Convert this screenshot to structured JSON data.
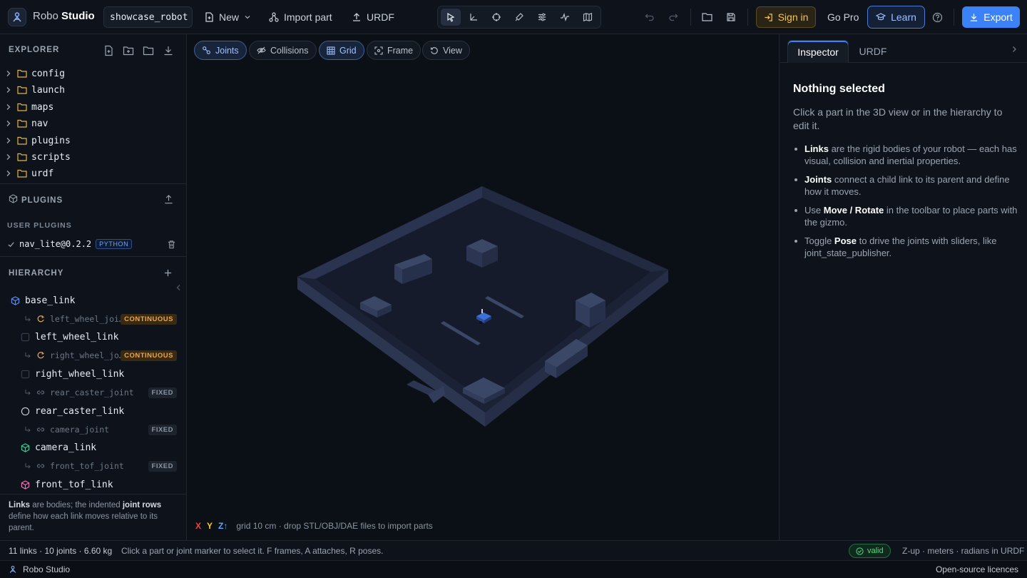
{
  "app": {
    "brand_light": "Robo",
    "brand_bold": "Studio",
    "project_name": "showcase_robot"
  },
  "toolbar": {
    "new_label": "New",
    "import_label": "Import part",
    "urdf_label": "URDF",
    "signin_label": "Sign in",
    "gopro_label": "Go Pro",
    "learn_label": "Learn",
    "export_label": "Export"
  },
  "explorer": {
    "title": "EXPLORER",
    "folders": [
      "config",
      "launch",
      "maps",
      "nav",
      "plugins",
      "scripts",
      "urdf"
    ]
  },
  "plugins": {
    "title": "PLUGINS",
    "user_title": "USER PLUGINS",
    "installed": "nav_lite@0.2.2",
    "lang_badge": "PYTHON"
  },
  "hierarchy": {
    "title": "HIERARCHY",
    "items": [
      {
        "kind": "link",
        "name": "base_link"
      },
      {
        "kind": "joint",
        "name": "left_wheel_joi…",
        "type": "CONTINUOUS"
      },
      {
        "kind": "link",
        "name": "left_wheel_link"
      },
      {
        "kind": "joint",
        "name": "right_wheel_jo…",
        "type": "CONTINUOUS"
      },
      {
        "kind": "link",
        "name": "right_wheel_link"
      },
      {
        "kind": "joint",
        "name": "rear_caster_joint",
        "type": "FIXED"
      },
      {
        "kind": "link",
        "name": "rear_caster_link"
      },
      {
        "kind": "joint",
        "name": "camera_joint",
        "type": "FIXED"
      },
      {
        "kind": "link",
        "name": "camera_link"
      },
      {
        "kind": "joint",
        "name": "front_tof_joint",
        "type": "FIXED"
      },
      {
        "kind": "link",
        "name": "front_tof_link"
      }
    ],
    "note_b1": "Links",
    "note_t1": " are bodies; the indented ",
    "note_b2": "joint rows",
    "note_t2": " define how each link moves relative to its parent."
  },
  "viewport": {
    "chips": {
      "joints": "Joints",
      "collisions": "Collisions",
      "grid": "Grid",
      "frame": "Frame",
      "view": "View"
    },
    "axis_x": "X",
    "axis_y": "Y",
    "axis_z": "Z↑",
    "hint": "grid 10 cm · drop STL/OBJ/DAE files to import parts"
  },
  "inspector": {
    "tab_active": "Inspector",
    "tab_other": "URDF",
    "title": "Nothing selected",
    "desc": "Click a part in the 3D view or in the hierarchy to edit it.",
    "bullets": [
      {
        "b": "Links",
        "t": " are the rigid bodies of your robot — each has visual, collision and inertial properties."
      },
      {
        "b": "Joints",
        "t": " connect a child link to its parent and define how it moves."
      },
      {
        "pre": "Use ",
        "b": "Move / Rotate",
        "t": " in the toolbar to place parts with the gizmo."
      },
      {
        "pre": "Toggle ",
        "b": "Pose",
        "t": " to drive the joints with sliders, like joint_state_publisher."
      }
    ]
  },
  "status": {
    "summary": "11 links · 10 joints · 6.60 kg",
    "hint": "Click a part or joint marker to select it. F frames, A attaches, R poses.",
    "valid": "valid",
    "units": "Z-up · meters · radians in URDF"
  },
  "footer": {
    "app_name": "Robo Studio",
    "licences": "Open-source licences"
  },
  "colors": {
    "accent": "#3b82f6",
    "continuous": "#e7a74a",
    "valid": "#4ade80",
    "warning": "#f3c356"
  }
}
